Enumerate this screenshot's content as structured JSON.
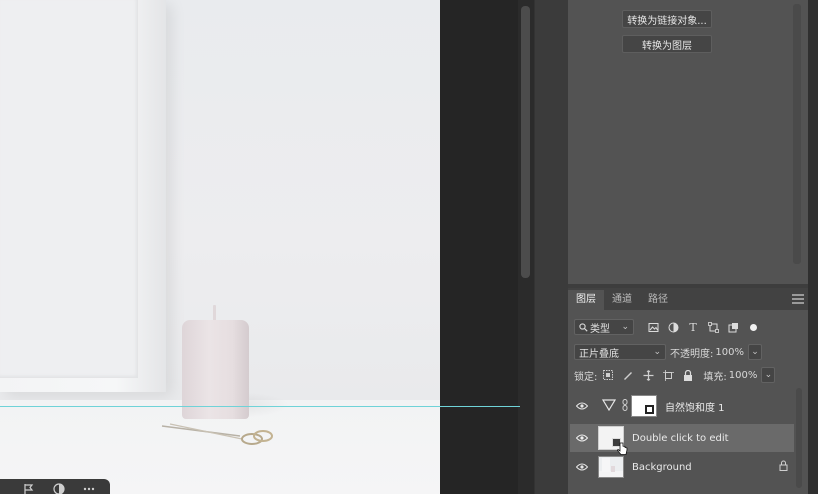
{
  "properties": {
    "buttons": [
      "转换为链接对象...",
      "转换为图层"
    ]
  },
  "layers_panel": {
    "tabs": [
      "图层",
      "通道",
      "路径"
    ],
    "active_tab": "图层",
    "filter_label": "类型",
    "blend_mode": "正片叠底",
    "opacity_label": "不透明度:",
    "opacity_value": "100%",
    "lock_label": "锁定:",
    "fill_label": "填充:",
    "fill_value": "100%",
    "layers": [
      {
        "name": "自然饱和度 1",
        "type": "adjustment",
        "visible": true,
        "selected": false,
        "locked": false
      },
      {
        "name": "Double click to edit",
        "type": "smart-object",
        "visible": true,
        "selected": true,
        "locked": false
      },
      {
        "name": "Background",
        "type": "background",
        "visible": true,
        "selected": false,
        "locked": true
      }
    ]
  },
  "colors": {
    "panel_bg": "#535353",
    "selected_layer_bg": "#6a6a6a",
    "guide_line": "#6fd3d8"
  }
}
